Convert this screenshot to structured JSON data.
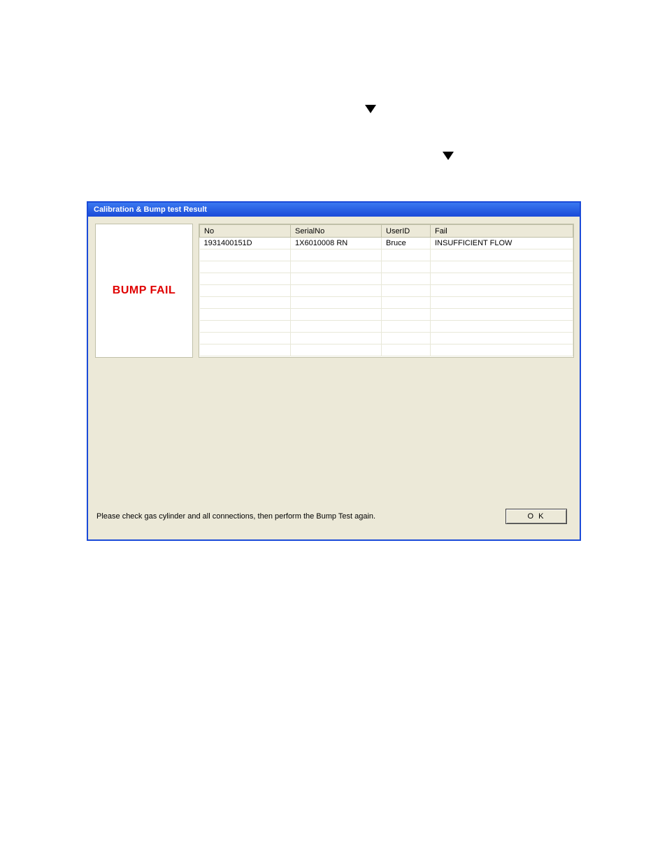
{
  "decorations": {
    "triangle1": "▼",
    "triangle2": "▼"
  },
  "dialog": {
    "title": "Calibration & Bump test Result",
    "status": "BUMP FAIL",
    "table": {
      "headers": {
        "no": "No",
        "serial": "SerialNo",
        "user": "UserID",
        "fail": "Fail"
      },
      "rows": [
        {
          "no": "1931400151D",
          "serial": "1X6010008 RN",
          "user": "Bruce",
          "fail": "INSUFFICIENT FLOW"
        },
        {
          "no": "",
          "serial": "",
          "user": "",
          "fail": ""
        },
        {
          "no": "",
          "serial": "",
          "user": "",
          "fail": ""
        },
        {
          "no": "",
          "serial": "",
          "user": "",
          "fail": ""
        },
        {
          "no": "",
          "serial": "",
          "user": "",
          "fail": ""
        },
        {
          "no": "",
          "serial": "",
          "user": "",
          "fail": ""
        },
        {
          "no": "",
          "serial": "",
          "user": "",
          "fail": ""
        },
        {
          "no": "",
          "serial": "",
          "user": "",
          "fail": ""
        },
        {
          "no": "",
          "serial": "",
          "user": "",
          "fail": ""
        },
        {
          "no": "",
          "serial": "",
          "user": "",
          "fail": ""
        }
      ]
    },
    "message": "Please check gas cylinder and all connections, then perform the Bump Test again.",
    "ok_label": "O K"
  }
}
